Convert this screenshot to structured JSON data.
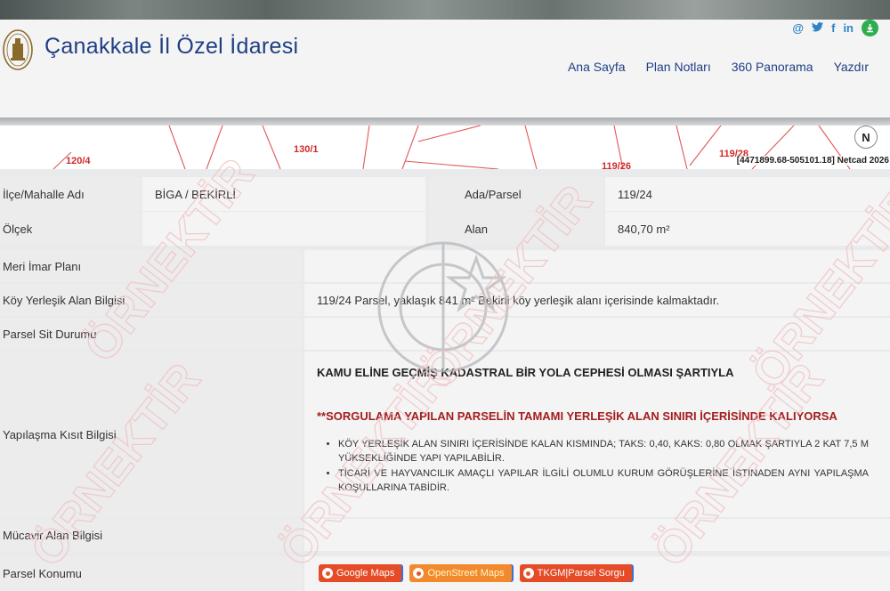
{
  "header": {
    "title": "Çanakkale İl Özel İdaresi",
    "social": [
      "@",
      "t",
      "f",
      "in"
    ],
    "nav": [
      "Ana Sayfa",
      "Plan Notları",
      "360 Panorama",
      "Yazdır"
    ]
  },
  "map": {
    "parcel_labels": [
      "120/4",
      "130/1",
      "119/26",
      "119/28"
    ],
    "coords": "[4471899.68-505101.18] Netcad 2026",
    "north": "N"
  },
  "info": {
    "ilce_label": "İlçe/Mahalle Adı",
    "ilce_value": "BİGA / BEKİRLİ",
    "ada_label": "Ada/Parsel",
    "ada_value": "119/24",
    "olcek_label": "Ölçek",
    "olcek_value": "",
    "alan_label": "Alan",
    "alan_value": "840,70 m²"
  },
  "rows": {
    "meri_label": "Meri İmar Planı",
    "koy_label": "Köy Yerleşik Alan Bilgisi",
    "koy_value": "119/24 Parsel, yaklaşık 841 m² Bekirli köy yerleşik alanı içerisinde kalmaktadır.",
    "sit_label": "Parsel Sit Durumu",
    "kisit_label": "Yapılaşma Kısıt Bilgisi",
    "kisit_heading": "KAMU ELİNE GEÇMİŞ KADASTRAL BİR YOLA CEPHESİ OLMASI ŞARTIYLA",
    "kisit_warning": "**SORGULAMA YAPILAN PARSELİN TAMAMI YERLEŞİK ALAN SINIRI İÇERİSİNDE KALIYORSA",
    "kisit_items": [
      "KÖY YERLEŞİK ALAN SINIRI İÇERİSİNDE KALAN KISMINDA; TAKS: 0,40, KAKS: 0,80 OLMAK ŞARTIYLA 2 KAT 7,5 M YÜKSEKLİĞİNDE YAPI YAPILABİLİR.",
      "TİCARİ VE HAYVANCILIK AMAÇLI YAPILAR İLGİLİ OLUMLU KURUM GÖRÜŞLERİNE İSTİNADEN AYNI YAPILAŞMA KOŞULLARINA TABİDİR."
    ],
    "mucavir_label": "Mücavir Alan Bilgisi",
    "konum_label": "Parsel Konumu"
  },
  "buttons": [
    "Google Maps",
    "OpenStreet Maps",
    "TKGM|Parsel Sorgu"
  ],
  "watermark": "ÖRNEKTİR",
  "colors": {
    "title": "#1f3f83",
    "warning": "#a41d1d",
    "button": "#e44b26",
    "map_lines": "#e05858"
  }
}
